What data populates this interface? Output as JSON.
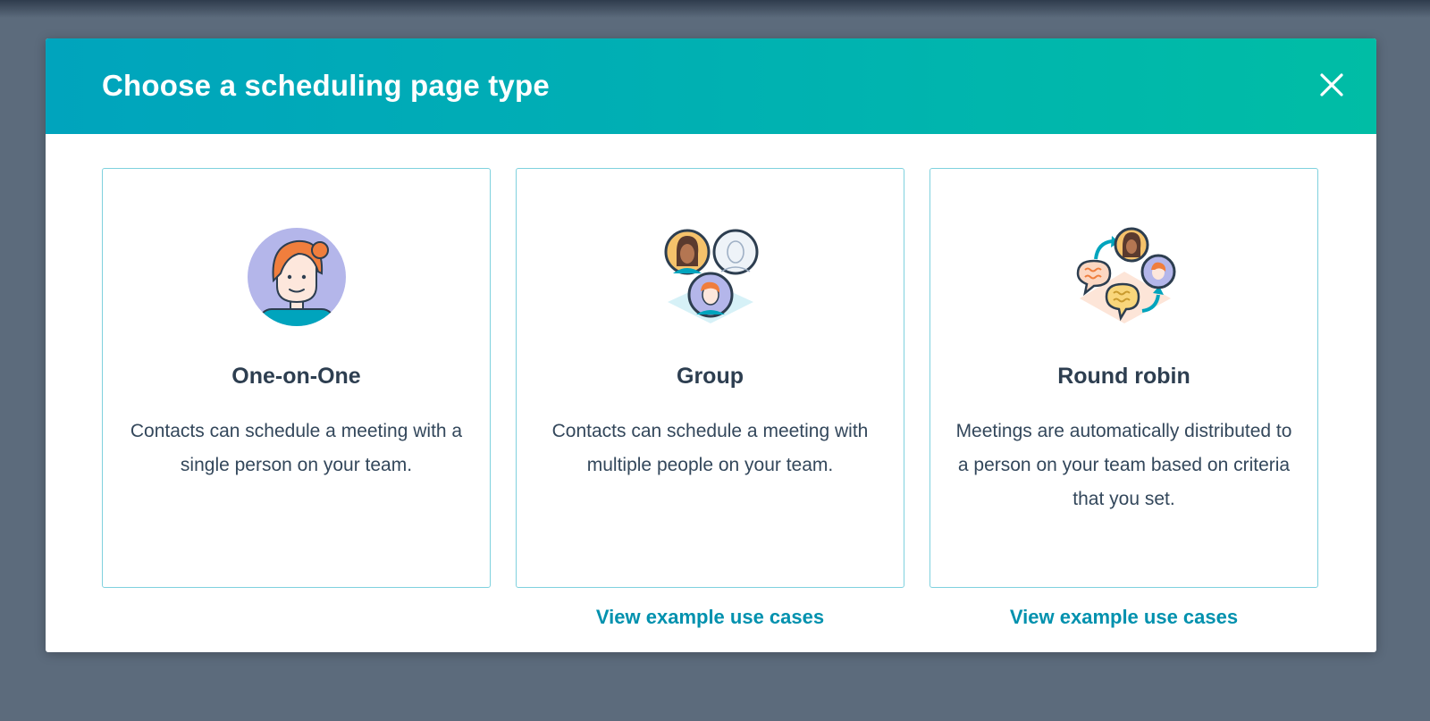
{
  "modal": {
    "title": "Choose a scheduling page type",
    "close_icon": "close-icon"
  },
  "cards": [
    {
      "title": "One-on-One",
      "description": "Contacts can schedule a meeting with a single person on your team.",
      "icon": "single-person-illustration",
      "link": ""
    },
    {
      "title": "Group",
      "description": "Contacts can schedule a meeting with multiple people on your team.",
      "icon": "group-people-illustration",
      "link": "View example use cases"
    },
    {
      "title": "Round robin",
      "description": "Meetings are automatically distributed to a person on your team based on criteria that you set.",
      "icon": "round-robin-illustration",
      "link": "View example use cases"
    }
  ],
  "colors": {
    "header_start": "#00a4bd",
    "header_end": "#00bda5",
    "card_border": "#7fd1de",
    "link": "#0091ae",
    "heading_text": "#2d3e50",
    "overlay": "#5c6b7c"
  }
}
